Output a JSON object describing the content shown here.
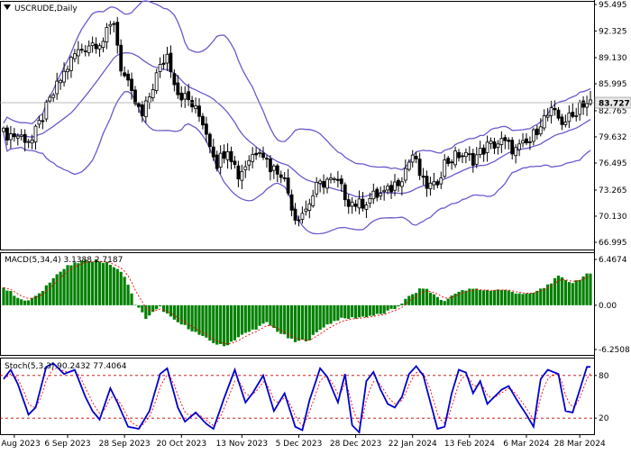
{
  "chart_data": [
    {
      "type": "candlestick",
      "title": "USCRUDE,Daily",
      "price_axis_ticks": [
        "95.495",
        "92.325",
        "89.130",
        "85.995",
        "82.765",
        "79.632",
        "76.495",
        "73.265",
        "70.130",
        "66.995"
      ],
      "ylim": [
        66.995,
        95.495
      ],
      "current_price": "83.727",
      "x_ticks": [
        {
          "label": "15 Aug 2023",
          "bar": 3
        },
        {
          "label": "6 Sep 2023",
          "bar": 18
        },
        {
          "label": "28 Sep 2023",
          "bar": 34
        },
        {
          "label": "20 Oct 2023",
          "bar": 50
        },
        {
          "label": "13 Nov 2023",
          "bar": 67
        },
        {
          "label": "5 Dec 2023",
          "bar": 83
        },
        {
          "label": "28 Dec 2023",
          "bar": 99
        },
        {
          "label": "22 Jan 2024",
          "bar": 115
        },
        {
          "label": "13 Feb 2024",
          "bar": 131
        },
        {
          "label": "6 Mar 2024",
          "bar": 147
        },
        {
          "label": "28 Mar 2024",
          "bar": 162
        }
      ],
      "close_path": [
        [
          0,
          80.0
        ],
        [
          4,
          79.8
        ],
        [
          8,
          79.2
        ],
        [
          12,
          83.0
        ],
        [
          16,
          86.5
        ],
        [
          20,
          89.5
        ],
        [
          24,
          90.8
        ],
        [
          28,
          91.2
        ],
        [
          31,
          93.5
        ],
        [
          33,
          88.0
        ],
        [
          36,
          84.5
        ],
        [
          39,
          82.0
        ],
        [
          43,
          87.0
        ],
        [
          46,
          89.5
        ],
        [
          49,
          85.0
        ],
        [
          52,
          84.0
        ],
        [
          56,
          81.5
        ],
        [
          60,
          76.5
        ],
        [
          63,
          78.5
        ],
        [
          66,
          75.0
        ],
        [
          69,
          77.0
        ],
        [
          72,
          78.5
        ],
        [
          75,
          76.0
        ],
        [
          78,
          75.5
        ],
        [
          80,
          73.0
        ],
        [
          82,
          70.0
        ],
        [
          85,
          71.0
        ],
        [
          88,
          73.5
        ],
        [
          91,
          74.5
        ],
        [
          94,
          74.0
        ],
        [
          97,
          72.0
        ],
        [
          100,
          71.5
        ],
        [
          104,
          72.5
        ],
        [
          108,
          73.0
        ],
        [
          112,
          75.0
        ],
        [
          115,
          77.5
        ],
        [
          118,
          74.0
        ],
        [
          121,
          73.5
        ],
        [
          124,
          76.5
        ],
        [
          128,
          77.5
        ],
        [
          132,
          77.0
        ],
        [
          136,
          78.5
        ],
        [
          140,
          79.0
        ],
        [
          144,
          78.0
        ],
        [
          148,
          79.0
        ],
        [
          151,
          81.5
        ],
        [
          154,
          82.5
        ],
        [
          157,
          81.5
        ],
        [
          160,
          82.0
        ],
        [
          162,
          83.7
        ]
      ],
      "bollinger_bands_color": "#6a5acd",
      "candle_color": "#000000"
    },
    {
      "type": "bar",
      "title": "MACD(5,34,4) 3.1388 2.7187",
      "name": "MACD",
      "ticks": [
        "6.4674",
        "0.00",
        "-6.2508"
      ],
      "ylim": [
        -6.2508,
        6.4674
      ],
      "histogram_color": "#008000",
      "signal_color": "#ff0000",
      "histogram_path": [
        [
          0,
          2.5
        ],
        [
          6,
          0.5
        ],
        [
          10,
          1.5
        ],
        [
          14,
          4.0
        ],
        [
          18,
          5.5
        ],
        [
          22,
          6.2
        ],
        [
          26,
          6.4
        ],
        [
          30,
          5.8
        ],
        [
          34,
          4.2
        ],
        [
          37,
          0.2
        ],
        [
          40,
          -1.8
        ],
        [
          44,
          -0.3
        ],
        [
          48,
          -2.2
        ],
        [
          52,
          -3.2
        ],
        [
          56,
          -4.5
        ],
        [
          60,
          -5.5
        ],
        [
          62,
          -5.8
        ],
        [
          66,
          -4.5
        ],
        [
          70,
          -3.5
        ],
        [
          74,
          -2.5
        ],
        [
          78,
          -4.0
        ],
        [
          82,
          -5.2
        ],
        [
          86,
          -4.8
        ],
        [
          90,
          -3.0
        ],
        [
          94,
          -2.0
        ],
        [
          100,
          -1.7
        ],
        [
          106,
          -1.3
        ],
        [
          110,
          -0.5
        ],
        [
          114,
          1.2
        ],
        [
          118,
          2.5
        ],
        [
          121,
          1.5
        ],
        [
          124,
          0.5
        ],
        [
          127,
          1.8
        ],
        [
          132,
          2.3
        ],
        [
          136,
          2.1
        ],
        [
          140,
          2.2
        ],
        [
          144,
          1.8
        ],
        [
          148,
          1.5
        ],
        [
          152,
          2.5
        ],
        [
          156,
          4.0
        ],
        [
          160,
          3.2
        ],
        [
          164,
          4.3
        ]
      ]
    },
    {
      "type": "line",
      "title": "Stoch(5,3,3) 90.2432 77.4064",
      "name": "Stochastic",
      "ticks": [
        "80",
        "20"
      ],
      "ylim": [
        0,
        100
      ],
      "levels": [
        80,
        20
      ],
      "k_color": "#0000cd",
      "d_color": "#ff0000",
      "k_path": [
        [
          0,
          75
        ],
        [
          2,
          88
        ],
        [
          4,
          68
        ],
        [
          7,
          25
        ],
        [
          9,
          35
        ],
        [
          12,
          92
        ],
        [
          14,
          97
        ],
        [
          17,
          82
        ],
        [
          20,
          88
        ],
        [
          23,
          50
        ],
        [
          25,
          30
        ],
        [
          27,
          18
        ],
        [
          30,
          62
        ],
        [
          32,
          42
        ],
        [
          35,
          8
        ],
        [
          38,
          5
        ],
        [
          41,
          30
        ],
        [
          44,
          82
        ],
        [
          46,
          90
        ],
        [
          49,
          35
        ],
        [
          51,
          15
        ],
        [
          54,
          28
        ],
        [
          57,
          12
        ],
        [
          59,
          5
        ],
        [
          62,
          48
        ],
        [
          65,
          88
        ],
        [
          68,
          42
        ],
        [
          70,
          55
        ],
        [
          73,
          80
        ],
        [
          76,
          30
        ],
        [
          79,
          55
        ],
        [
          82,
          8
        ],
        [
          84,
          3
        ],
        [
          86,
          45
        ],
        [
          89,
          90
        ],
        [
          91,
          78
        ],
        [
          94,
          42
        ],
        [
          96,
          82
        ],
        [
          98,
          10
        ],
        [
          100,
          0
        ],
        [
          102,
          72
        ],
        [
          104,
          85
        ],
        [
          106,
          60
        ],
        [
          108,
          40
        ],
        [
          110,
          35
        ],
        [
          112,
          50
        ],
        [
          114,
          82
        ],
        [
          116,
          93
        ],
        [
          118,
          80
        ],
        [
          120,
          42
        ],
        [
          122,
          5
        ],
        [
          124,
          8
        ],
        [
          126,
          55
        ],
        [
          128,
          88
        ],
        [
          130,
          84
        ],
        [
          132,
          55
        ],
        [
          134,
          72
        ],
        [
          136,
          40
        ],
        [
          138,
          50
        ],
        [
          140,
          60
        ],
        [
          142,
          65
        ],
        [
          145,
          40
        ],
        [
          147,
          25
        ],
        [
          149,
          8
        ],
        [
          151,
          75
        ],
        [
          153,
          88
        ],
        [
          156,
          82
        ],
        [
          158,
          30
        ],
        [
          160,
          28
        ],
        [
          162,
          60
        ],
        [
          164,
          92
        ]
      ]
    }
  ]
}
